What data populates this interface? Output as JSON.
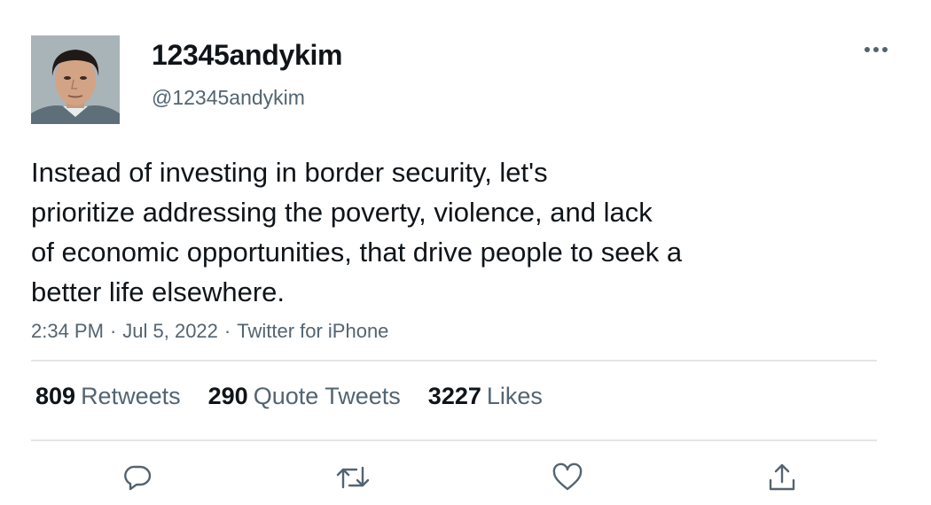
{
  "author": {
    "display_name": "12345andykim",
    "handle": "@12345andykim"
  },
  "tweet": {
    "text_lines": [
      "Instead of investing in border security, let's",
      "prioritize addressing the poverty, violence, and lack",
      "of economic opportunities, that drive people to seek a",
      "better life elsewhere."
    ],
    "time": "2:34 PM",
    "date": "Jul 5, 2022",
    "source": "Twitter for iPhone",
    "separator": "·"
  },
  "stats": {
    "retweets": {
      "count": "809",
      "label": "Retweets"
    },
    "quotes": {
      "count": "290",
      "label": "Quote Tweets"
    },
    "likes": {
      "count": "3227",
      "label": "Likes"
    }
  },
  "actions": [
    "reply-icon",
    "retweet-icon",
    "like-icon",
    "share-icon"
  ],
  "colors": {
    "text_primary": "#0f1419",
    "text_secondary": "#536471",
    "divider": "#e3e6e8"
  }
}
